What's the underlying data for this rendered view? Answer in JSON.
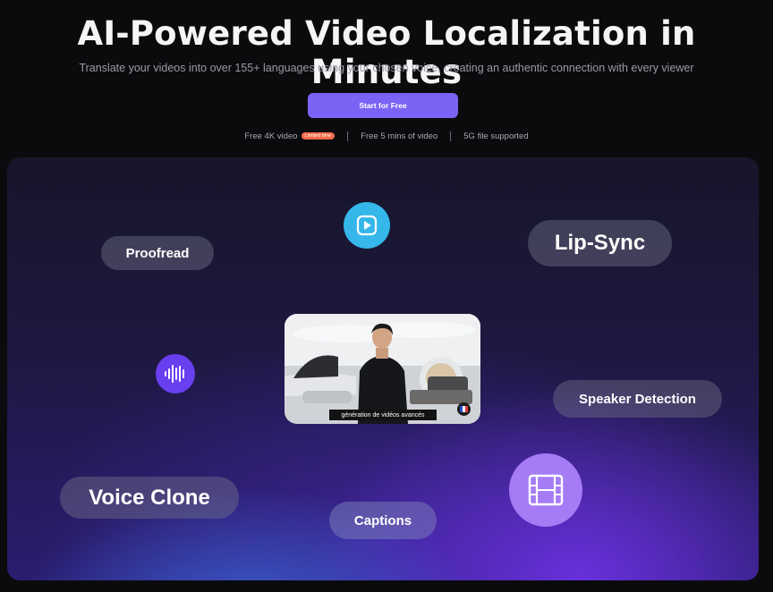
{
  "hero": {
    "title": "AI-Powered Video Localization in Minutes",
    "subtitle": "Translate your videos into over 155+ languages using your chosen voice, creating an authentic connection with every viewer",
    "cta_label": "Start for Free",
    "perks": [
      {
        "text": "Free 4K video",
        "badge": "Limited time"
      },
      {
        "text": "Free 5 mins of video"
      },
      {
        "text": "5G file supported"
      }
    ]
  },
  "features": {
    "proofread": "Proofread",
    "lip_sync": "Lip-Sync",
    "speaker_detection": "Speaker Detection",
    "voice_clone": "Voice Clone",
    "captions": "Captions"
  },
  "video": {
    "caption_text": "génération de vidéos avancés"
  },
  "icons": {
    "play": "play-icon",
    "soundwave": "soundwave-icon",
    "film": "film-icon",
    "flag": "french-flag-icon"
  },
  "colors": {
    "accent": "#7b63f5",
    "badge": "#f06b47",
    "play_circle": "#35b7ea",
    "wave_circle": "#6a3ff0",
    "film_circle": "#a57cf6"
  }
}
